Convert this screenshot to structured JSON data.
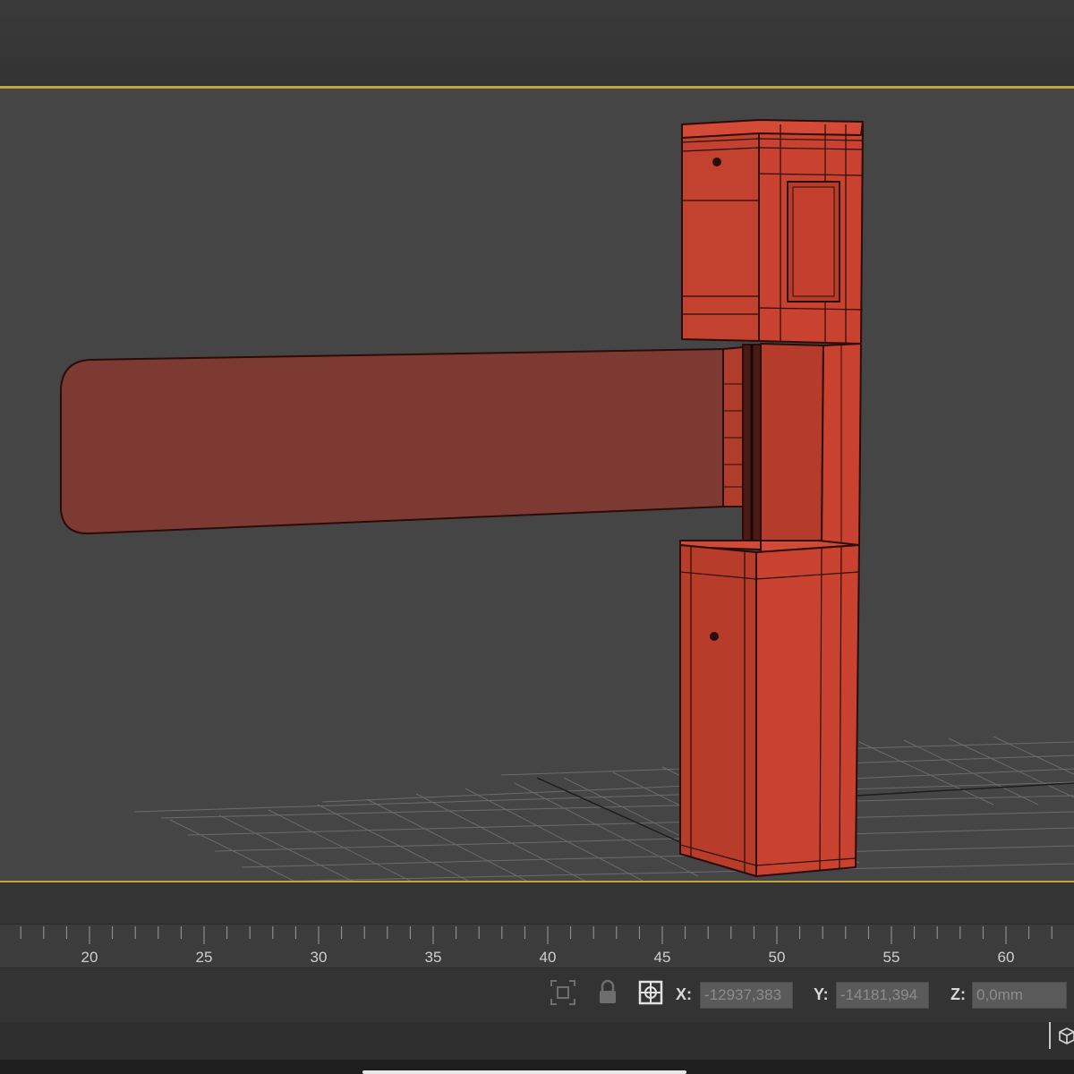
{
  "timeline": {
    "ruler_labels": [
      "20",
      "25",
      "30",
      "35",
      "40",
      "45",
      "50",
      "55",
      "60"
    ]
  },
  "status": {
    "x_label": "X:",
    "x_value": "-12937,383",
    "y_label": "Y:",
    "y_value": "-14181,394",
    "z_label": "Z:",
    "z_value": "0,0mm",
    "icons": [
      "selection-frame-icon",
      "lock-icon",
      "absolute-mode-icon",
      "viewcube-icon"
    ]
  },
  "viewport": {
    "object_color": "#c9422f",
    "grid_color": "#6a6a6a",
    "border_color": "#c2a23a"
  }
}
